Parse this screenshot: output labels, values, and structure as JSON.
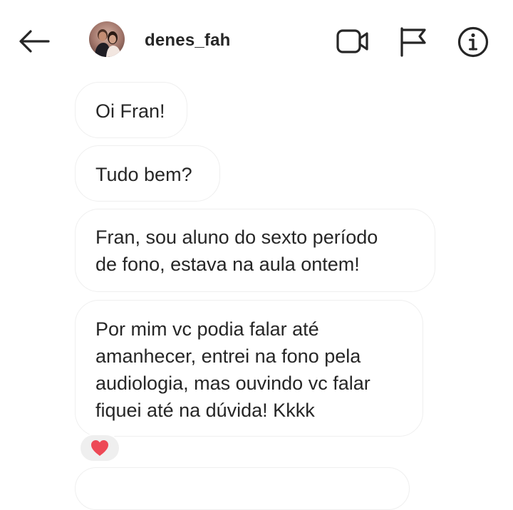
{
  "header": {
    "username": "denes_fah",
    "icons": {
      "back": "arrow-left-icon",
      "video": "video-camera-icon",
      "flag": "flag-icon",
      "info": "info-icon"
    }
  },
  "messages": [
    {
      "text": "Oi Fran!"
    },
    {
      "text": "Tudo bem?"
    },
    {
      "text": "Fran, sou aluno do sexto período\nde fono, estava na aula ontem!"
    },
    {
      "text": "Por mim vc podia falar até\namanhecer, entrei na fono pela\naudiologia, mas ouvindo vc falar\nfiquei até na dúvida! Kkkk"
    }
  ],
  "reaction": {
    "emoji": "heart-icon",
    "color": "#ed4956"
  },
  "colors": {
    "text": "#262626",
    "bubble_border": "#efefef",
    "reaction_bg": "#efefef",
    "background": "#ffffff"
  }
}
